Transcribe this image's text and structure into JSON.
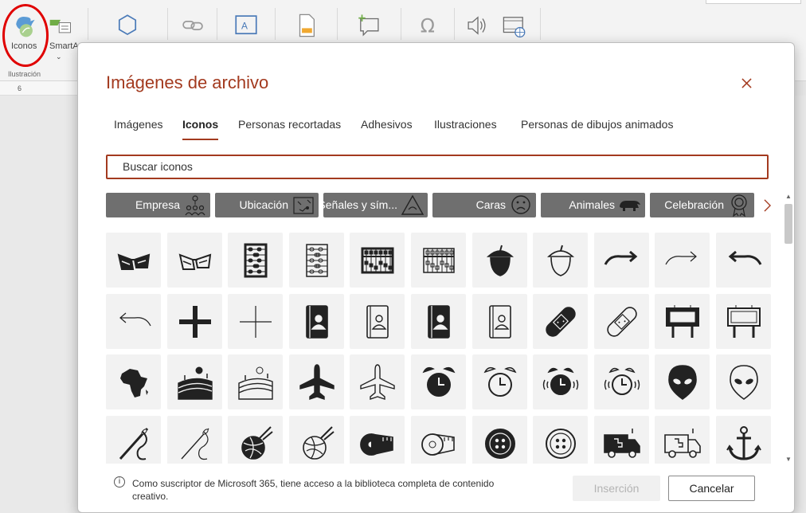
{
  "ribbon": {
    "icons_label": "Iconos",
    "smartart_label": "SmartArt",
    "group_label": "Ilustración",
    "ruler_mark": "6"
  },
  "dialog": {
    "title": "Imágenes de archivo",
    "tabs": [
      {
        "label": "Imágenes",
        "active": false
      },
      {
        "label": "Iconos",
        "active": true
      },
      {
        "label": "Personas recortadas",
        "active": false
      },
      {
        "label": "Adhesivos",
        "active": false
      },
      {
        "label": "Ilustraciones",
        "active": false
      },
      {
        "label": "Personas de dibujos animados",
        "active": false
      }
    ],
    "search": {
      "placeholder": "Buscar iconos"
    },
    "categories": [
      {
        "label": "Empresa",
        "icon": "people-network-icon"
      },
      {
        "label": "Ubicación",
        "icon": "map-icon"
      },
      {
        "label": "Señales y sím...",
        "icon": "warning-sign-icon"
      },
      {
        "label": "Caras",
        "icon": "sad-face-icon"
      },
      {
        "label": "Animales",
        "icon": "rhino-icon"
      },
      {
        "label": "Celebración",
        "icon": "award-ribbon-icon"
      }
    ],
    "icon_rows": [
      [
        "3d-glasses-filled-icon",
        "3d-glasses-outline-icon",
        "abacus-filled-icon",
        "abacus-outline-icon",
        "abacus-wide-filled-icon",
        "abacus-wide-outline-icon",
        "acorn-filled-icon",
        "acorn-outline-icon",
        "arrow-curve-right-bold-icon",
        "arrow-curve-right-thin-icon",
        "arrow-curve-left-bold-icon"
      ],
      [
        "arrow-curve-left-thin-icon",
        "plus-bold-icon",
        "plus-thin-icon",
        "address-book-filled-icon",
        "address-book-outline-icon",
        "contact-book-filled-icon",
        "contact-book-outline-icon",
        "bandage-filled-icon",
        "bandage-outline-icon",
        "billboard-filled-icon",
        "billboard-outline-icon"
      ],
      [
        "africa-map-icon",
        "farm-field-filled-icon",
        "farm-field-outline-icon",
        "airplane-filled-icon",
        "airplane-outline-icon",
        "alarm-clock-filled-icon",
        "alarm-clock-outline-icon",
        "alarm-ringing-filled-icon",
        "alarm-ringing-outline-icon",
        "alien-face-filled-icon",
        "alien-face-outline-icon"
      ],
      [
        "needle-thread-filled-icon",
        "needle-thread-outline-icon",
        "yarn-ball-filled-icon",
        "yarn-ball-outline-icon",
        "tape-measure-filled-icon",
        "tape-measure-outline-icon",
        "button-filled-icon",
        "button-outline-icon",
        "ambulance-filled-icon",
        "ambulance-outline-icon",
        "anchor-icon"
      ]
    ],
    "footer_text": "Como suscriptor de Microsoft 365, tiene acceso a la biblioteca completa de contenido creativo.",
    "insert_label": "Inserción",
    "cancel_label": "Cancelar",
    "accent_color": "#a33a1f"
  }
}
